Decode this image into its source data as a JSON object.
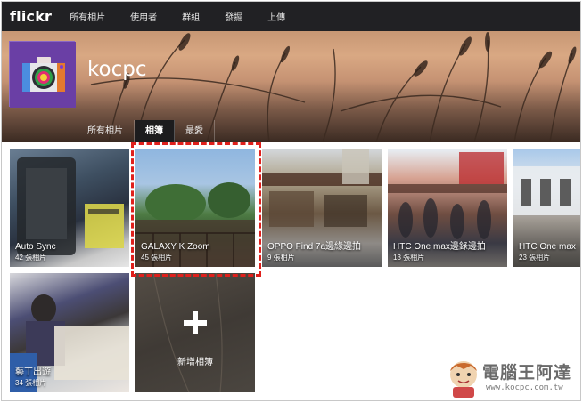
{
  "topnav": {
    "logo": "flickr",
    "links": [
      "所有相片",
      "使用者",
      "群組",
      "發掘",
      "上傳"
    ]
  },
  "profile": {
    "username": "kocpc",
    "subtabs": [
      "所有相片",
      "相簿",
      "最愛"
    ],
    "active_subtab": "相簿"
  },
  "albums": [
    {
      "title": "Auto Sync",
      "count": "42 張相片"
    },
    {
      "title": "GALAXY K Zoom",
      "count": "45 張相片"
    },
    {
      "title": "OPPO Find 7a邊緣邊拍",
      "count": "9 張相片"
    },
    {
      "title": "HTC One max邊錄邊拍",
      "count": "13 張相片"
    },
    {
      "title": "HTC One max",
      "count": "23 張相片"
    },
    {
      "title": "藝丁出遊",
      "count": "34 張相片"
    }
  ],
  "add_album_label": "新增相簿",
  "watermark": {
    "brand": "電腦王阿達",
    "url": "www.kocpc.com.tw"
  },
  "colors": {
    "nav_bg": "#212124",
    "highlight": "#e0201c",
    "avatar_bg": "#6a3fa5"
  }
}
